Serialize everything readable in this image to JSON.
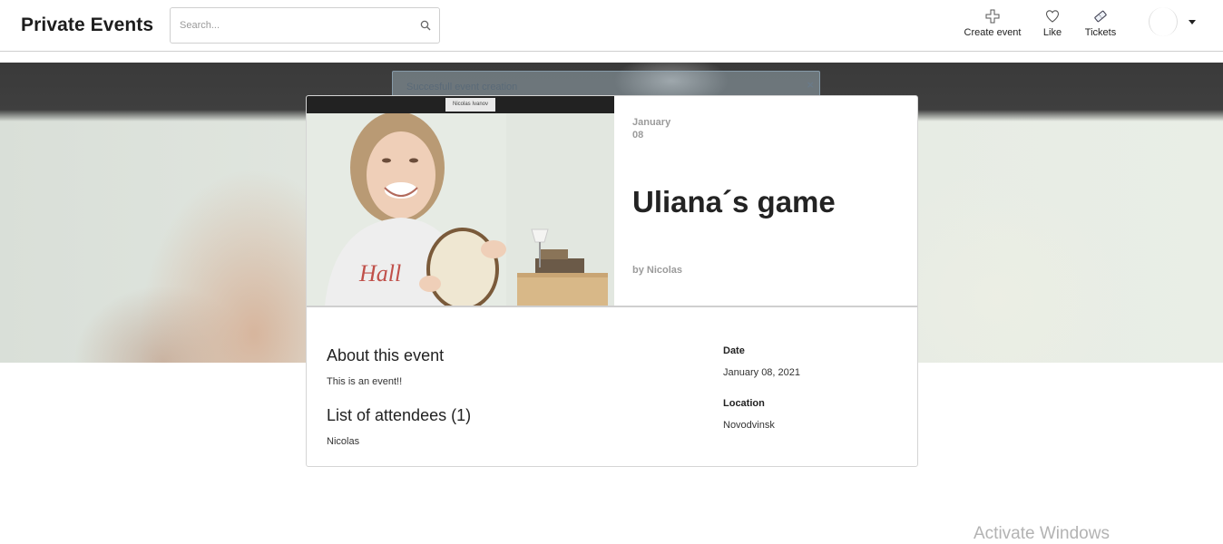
{
  "header": {
    "brand": "Private Events",
    "search_placeholder": "Search...",
    "nav": {
      "create": "Create event",
      "like": "Like",
      "tickets": "Tickets"
    }
  },
  "alert": {
    "message": "Succesfull event creation",
    "close": "×"
  },
  "photo": {
    "caption": "Nicolas Ivanov"
  },
  "event": {
    "month": "January",
    "day": "08",
    "title": "Uliana´s game",
    "by": "by Nicolas",
    "about_heading": "About this event",
    "description": "This is an event!!",
    "attendees_heading": "List of attendees (1)",
    "attendees": [
      "Nicolas"
    ],
    "date_label": "Date",
    "date_value": "January 08, 2021",
    "location_label": "Location",
    "location_value": "Novodvinsk"
  },
  "system": {
    "watermark": "Activate Windows"
  }
}
